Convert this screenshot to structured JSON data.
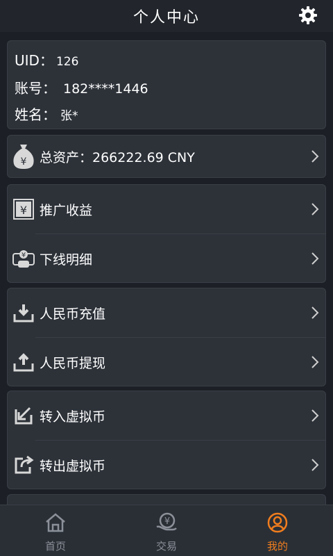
{
  "header": {
    "title": "个人中心",
    "settings_icon": "gear-icon"
  },
  "profile": {
    "uid_label": "UID：",
    "uid_value": "126",
    "account_label": "账号：",
    "account_value": "182****1446",
    "name_label": "姓名：",
    "name_value": "张*"
  },
  "assets": {
    "label": "总资产：266222.69 CNY",
    "icon": "money-bag-icon"
  },
  "menu": {
    "promotion_income": "推广收益",
    "downline_detail": "下线明细",
    "rmb_deposit": "人民币充值",
    "rmb_withdraw": "人民币提现",
    "transfer_in_coin": "转入虚拟币",
    "transfer_out_coin": "转出虚拟币"
  },
  "tabs": [
    {
      "label": "首页",
      "icon": "home-icon",
      "active": false
    },
    {
      "label": "交易",
      "icon": "exchange-icon",
      "active": false
    },
    {
      "label": "我的",
      "icon": "user-icon",
      "active": true
    }
  ],
  "colors": {
    "background": "#1c2026",
    "card": "#2d3239",
    "accent": "#f07d1e",
    "tab_inactive": "#8c9199"
  }
}
